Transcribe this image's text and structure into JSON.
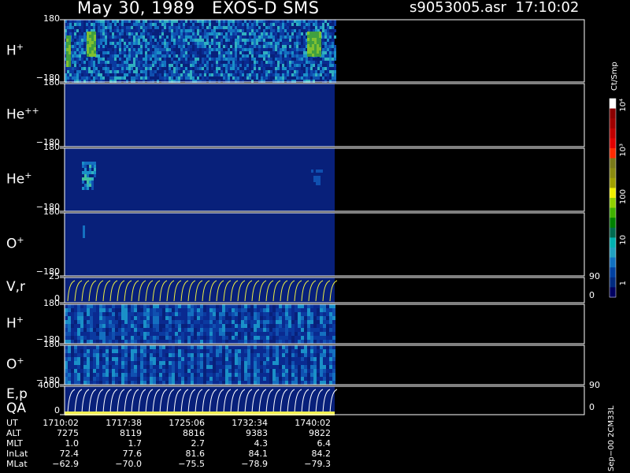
{
  "header": {
    "title_left": "May 30, 1989   EXOS-D SMS",
    "title_right": "s9053005.asr  17:10:02"
  },
  "colors": {
    "bg": "#000000",
    "spectro_bg": "#08207a",
    "line": "#ffffff",
    "vel_line": "#f0f040",
    "qa_bar": "#f4f050"
  },
  "panels": [
    {
      "key": "hp1",
      "label": "H",
      "sup": "+",
      "ytop": "180",
      "ybot": "−180"
    },
    {
      "key": "hepp",
      "label": "He",
      "sup": "++",
      "ytop": "180",
      "ybot": "−180"
    },
    {
      "key": "hep",
      "label": "He",
      "sup": "+",
      "ytop": "180",
      "ybot": "−180"
    },
    {
      "key": "op1",
      "label": "O",
      "sup": "+",
      "ytop": "180",
      "ybot": "−180"
    },
    {
      "key": "vr",
      "label": "V,r",
      "sup": "",
      "ytop": "25",
      "ybot": "0",
      "rtop": "90",
      "rbot": "0"
    },
    {
      "key": "hp2",
      "label": "H",
      "sup": "+",
      "ytop": "180",
      "ybot": "−180"
    },
    {
      "key": "op2",
      "label": "O",
      "sup": "+",
      "ytop": "180",
      "ybot": "−180"
    },
    {
      "key": "ep",
      "label": "E,p",
      "sup": "",
      "label2": "QA",
      "ytop": "4000",
      "ybot": "0",
      "rtop": "90",
      "rbot": "0"
    }
  ],
  "colorbar": {
    "unit": "Ct/Smp",
    "tick_labels": [
      "10⁴",
      "10³",
      "100",
      "10",
      "1"
    ],
    "colors": [
      "#ffffff",
      "#8b0000",
      "#a00000",
      "#c00000",
      "#e00000",
      "#ff2a00",
      "#7a7a1a",
      "#8a8a10",
      "#a0a000",
      "#f0f000",
      "#90d000",
      "#40b000",
      "#008000",
      "#006a50",
      "#00b0b0",
      "#20a0c0",
      "#1070c0",
      "#0040a0",
      "#002a80",
      "#000060"
    ]
  },
  "ephemeris": {
    "rows": [
      {
        "name": "UT",
        "values": [
          "1710:02",
          "1717:38",
          "1725:06",
          "1732:34",
          "1740:02"
        ]
      },
      {
        "name": "ALT",
        "values": [
          "7275",
          "8119",
          "8816",
          "9383",
          "9822"
        ]
      },
      {
        "name": "MLT",
        "values": [
          "1.0",
          "1.7",
          "2.7",
          "4.3",
          "6.4"
        ]
      },
      {
        "name": "InLat",
        "values": [
          "72.4",
          "77.6",
          "81.6",
          "84.1",
          "84.2"
        ]
      },
      {
        "name": "MLat",
        "values": [
          "−62.9",
          "−70.0",
          "−75.5",
          "−78.9",
          "−79.3"
        ]
      }
    ]
  },
  "footer_id": "Sep−00 2CM33L",
  "chart_data": {
    "type": "heatmap",
    "title": "May 30, 1989   EXOS-D SMS",
    "x_ticks": [
      "1710:02",
      "1717:38",
      "1725:06",
      "1732:34",
      "1740:02"
    ],
    "data_coverage_fraction": 0.45,
    "panels": [
      {
        "name": "H+",
        "ylim": [
          -180,
          180
        ]
      },
      {
        "name": "He++",
        "ylim": [
          -180,
          180
        ]
      },
      {
        "name": "He+",
        "ylim": [
          -180,
          180
        ]
      },
      {
        "name": "O+",
        "ylim": [
          -180,
          180
        ]
      },
      {
        "name": "V,r",
        "ylim": [
          0,
          25
        ],
        "right_ylim": [
          0,
          90
        ]
      },
      {
        "name": "H+",
        "ylim": [
          -180,
          180
        ]
      },
      {
        "name": "O+",
        "ylim": [
          -180,
          180
        ]
      },
      {
        "name": "E,p / QA",
        "ylim": [
          0,
          4000
        ],
        "right_ylim": [
          0,
          90
        ]
      }
    ],
    "colorbar_ticks": [
      1,
      10,
      100,
      1000,
      10000
    ],
    "colorbar_unit": "Ct/Smp"
  }
}
